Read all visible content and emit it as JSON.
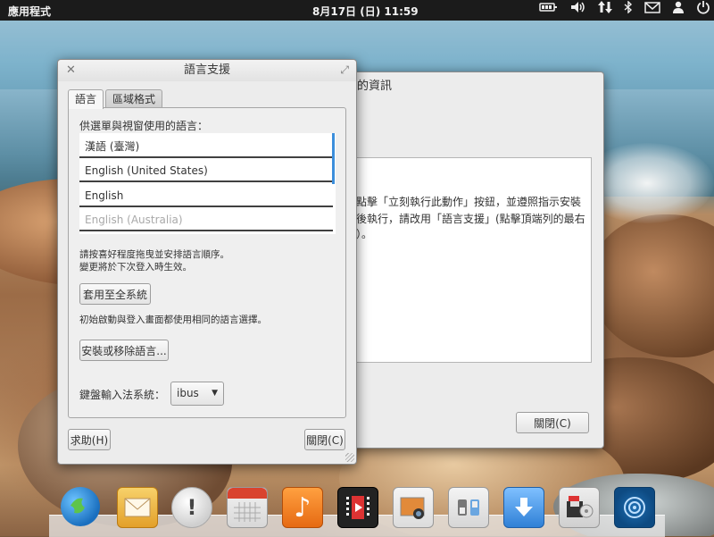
{
  "panel": {
    "applications": "應用程式",
    "clock": "8月17日 (日) 11:59",
    "tray_icons": [
      "network-icon",
      "volume-icon",
      "transfer-icon",
      "bluetooth-icon",
      "mail-icon",
      "user-icon",
      "power-icon"
    ]
  },
  "background_window": {
    "title": "的資訊",
    "text_lines": [
      "點擊「立刻執行此動作」按鈕，並遵照指示安裝",
      "後執行，請改用「語言支援」(點擊頂端列的最右",
      "）。"
    ],
    "close_button": "關閉(C)"
  },
  "main_window": {
    "title": "語言支援",
    "tabs": [
      "語言",
      "區域格式"
    ],
    "list_label": "供選單與視窗使用的語言：",
    "languages": [
      "漢語 (臺灣)",
      "English (United States)",
      "English",
      "English (Australia)"
    ],
    "order_hint_line1": "請按喜好程度拖曳並安排語言順序。",
    "order_hint_line2": "變更將於下次登入時生效。",
    "apply_system_button": "套用至全系統",
    "apply_hint": "初始啟動與登入畫面都使用相同的語言選擇。",
    "install_remove_button": "安裝或移除語言...",
    "input_method_label": "鍵盤輸入法系統：",
    "input_method_value": "ibus",
    "help_button": "求助(H)",
    "close_button": "關閉(C)"
  },
  "dock": {
    "items": [
      "browser-icon",
      "mail-icon",
      "notifications-icon",
      "calendar-icon",
      "music-icon",
      "video-icon",
      "photos-icon",
      "settings-icon",
      "downloads-icon",
      "backup-icon",
      "software-center-icon"
    ]
  },
  "colors": {
    "panel_bg": "#1b1b1b",
    "selection_accent": "#3c8edb",
    "window_bg": "#ececec"
  }
}
